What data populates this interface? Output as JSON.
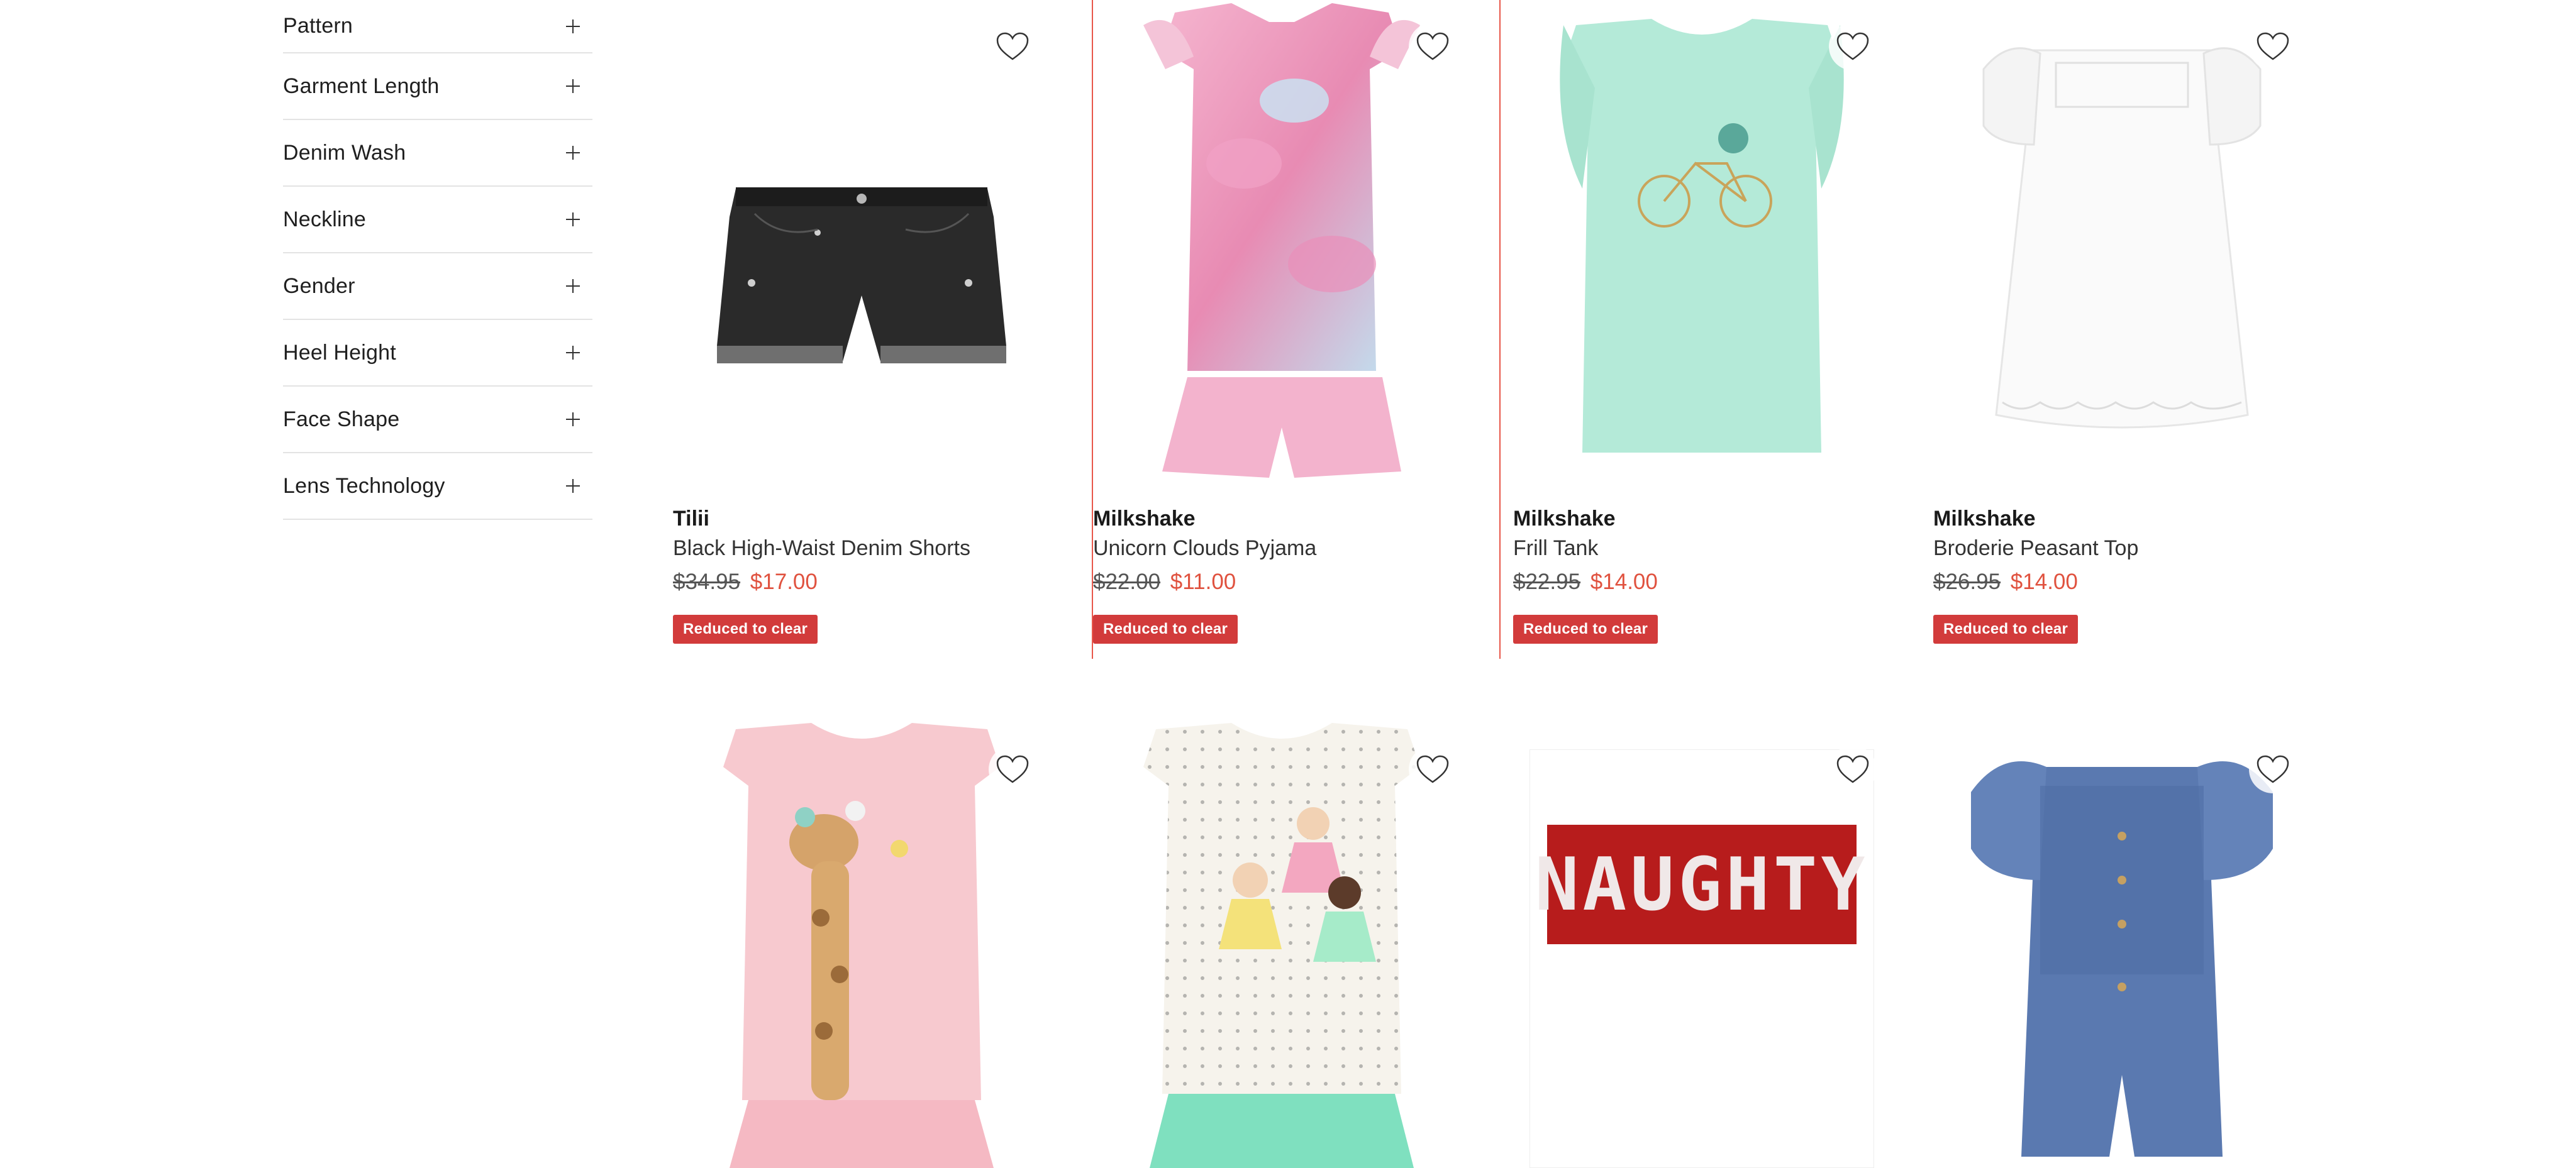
{
  "filters": [
    {
      "label": "Pattern"
    },
    {
      "label": "Garment Length"
    },
    {
      "label": "Denim Wash"
    },
    {
      "label": "Neckline"
    },
    {
      "label": "Gender"
    },
    {
      "label": "Heel Height"
    },
    {
      "label": "Face Shape"
    },
    {
      "label": "Lens Technology"
    }
  ],
  "products": [
    {
      "brand": "Tilii",
      "name": "Black High-Waist Denim Shorts",
      "old_price": "$34.95",
      "new_price": "$17.00",
      "badge": "Reduced to clear"
    },
    {
      "brand": "Milkshake",
      "name": "Unicorn Clouds Pyjama",
      "old_price": "$22.00",
      "new_price": "$11.00",
      "badge": "Reduced to clear"
    },
    {
      "brand": "Milkshake",
      "name": "Frill Tank",
      "old_price": "$22.95",
      "new_price": "$14.00",
      "badge": "Reduced to clear"
    },
    {
      "brand": "Milkshake",
      "name": "Broderie Peasant Top",
      "old_price": "$26.95",
      "new_price": "$14.00",
      "badge": "Reduced to clear"
    },
    {
      "brand": "",
      "name": "",
      "old_price": "",
      "new_price": "",
      "badge": ""
    },
    {
      "brand": "",
      "name": "",
      "old_price": "",
      "new_price": "",
      "badge": ""
    },
    {
      "brand": "",
      "name": "",
      "old_price": "",
      "new_price": "",
      "badge": "",
      "print_text": "NAUGHTY"
    },
    {
      "brand": "",
      "name": "",
      "old_price": "",
      "new_price": "",
      "badge": ""
    }
  ],
  "colors": {
    "sale_price": "#e0523f",
    "badge_bg": "#d23b3b",
    "active_border": "#e8574a"
  },
  "icons": {
    "filter_expand": "plus-icon",
    "wishlist": "heart-outline-icon"
  }
}
